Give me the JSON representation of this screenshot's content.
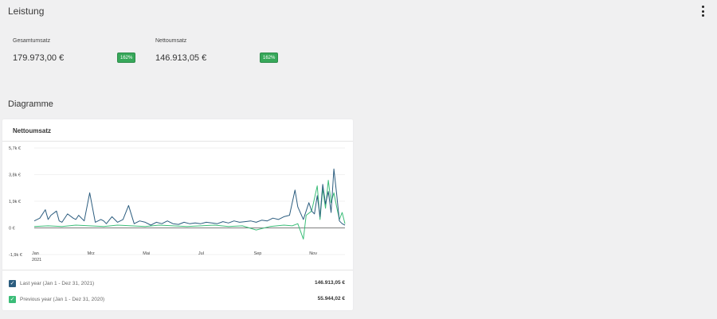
{
  "header": {
    "title": "Leistung",
    "more_icon": "more-vertical-icon"
  },
  "kpis": [
    {
      "label": "Gesamtumsatz",
      "value": "179.973,00 €",
      "badge": "162%"
    },
    {
      "label": "Nettoumsatz",
      "value": "146.913,05 €",
      "badge": "162%"
    }
  ],
  "charts_section": {
    "title": "Diagramme"
  },
  "chart_card": {
    "title": "Nettoumsatz",
    "legend": [
      {
        "label": "Last year (Jan 1 - Dez 31, 2021)",
        "value": "146.913,05 €",
        "color": "#2c5d7f"
      },
      {
        "label": "Previous year (Jan 1 - Dez 31, 2020)",
        "value": "55.944,02 €",
        "color": "#3bbd78"
      }
    ]
  },
  "chart_data": {
    "type": "line",
    "title": "Nettoumsatz",
    "xlabel": "",
    "ylabel": "",
    "y_tick_labels": [
      "5,7k €",
      "3,8k €",
      "1,9k €",
      "0 €",
      "-1,9k €"
    ],
    "y_ticks": [
      5700,
      3800,
      1900,
      0,
      -1900
    ],
    "ylim": [
      -1900,
      5700
    ],
    "x_tick_labels": [
      "Jan",
      "Mrz",
      "Mai",
      "Jul",
      "Sep",
      "Nov"
    ],
    "x_tick_months": [
      1,
      3,
      5,
      7,
      9,
      11
    ],
    "x_sublabel": "2021",
    "grid": true,
    "series": [
      {
        "name": "Last year (Jan 1 - Dez 31, 2021)",
        "color": "#2c5d7f",
        "x": [
          1.0,
          1.2,
          1.4,
          1.5,
          1.6,
          1.8,
          1.9,
          2.0,
          2.2,
          2.4,
          2.5,
          2.6,
          2.8,
          3.0,
          3.2,
          3.4,
          3.5,
          3.6,
          3.8,
          4.0,
          4.2,
          4.4,
          4.6,
          4.8,
          5.0,
          5.2,
          5.4,
          5.6,
          5.8,
          6.0,
          6.2,
          6.4,
          6.6,
          6.8,
          7.0,
          7.2,
          7.4,
          7.6,
          7.8,
          8.0,
          8.2,
          8.4,
          8.6,
          8.8,
          9.0,
          9.2,
          9.4,
          9.6,
          9.8,
          10.0,
          10.2,
          10.4,
          10.5,
          10.7,
          10.9,
          11.0,
          11.1,
          11.2,
          11.3,
          11.4,
          11.5,
          11.6,
          11.7,
          11.8,
          11.9,
          12.0,
          12.1,
          12.2
        ],
        "y": [
          500,
          700,
          1300,
          600,
          900,
          1200,
          500,
          400,
          1000,
          700,
          600,
          900,
          500,
          2500,
          400,
          600,
          500,
          300,
          800,
          400,
          600,
          1600,
          300,
          500,
          400,
          200,
          400,
          300,
          500,
          300,
          250,
          400,
          300,
          350,
          300,
          400,
          350,
          300,
          450,
          350,
          500,
          400,
          450,
          500,
          400,
          550,
          500,
          700,
          600,
          800,
          900,
          2700,
          1500,
          600,
          1800,
          1200,
          1000,
          2300,
          800,
          3100,
          1700,
          2600,
          1100,
          4200,
          2400,
          500,
          300,
          200
        ]
      },
      {
        "name": "Previous year (Jan 1 - Dez 31, 2020)",
        "color": "#3bbd78",
        "x": [
          1.0,
          1.5,
          2.0,
          2.5,
          3.0,
          3.5,
          4.0,
          4.5,
          5.0,
          5.5,
          6.0,
          6.5,
          7.0,
          7.5,
          8.0,
          8.5,
          9.0,
          9.5,
          10.0,
          10.3,
          10.5,
          10.7,
          10.8,
          11.0,
          11.1,
          11.2,
          11.3,
          11.4,
          11.5,
          11.6,
          11.7,
          11.8,
          11.9,
          12.0,
          12.1,
          12.2
        ],
        "y": [
          100,
          150,
          100,
          200,
          150,
          100,
          200,
          150,
          100,
          200,
          150,
          100,
          150,
          200,
          100,
          150,
          -150,
          100,
          200,
          150,
          300,
          -800,
          900,
          1200,
          2100,
          3000,
          600,
          2800,
          1400,
          3400,
          1800,
          2500,
          1500,
          600,
          1100,
          300
        ]
      }
    ]
  }
}
